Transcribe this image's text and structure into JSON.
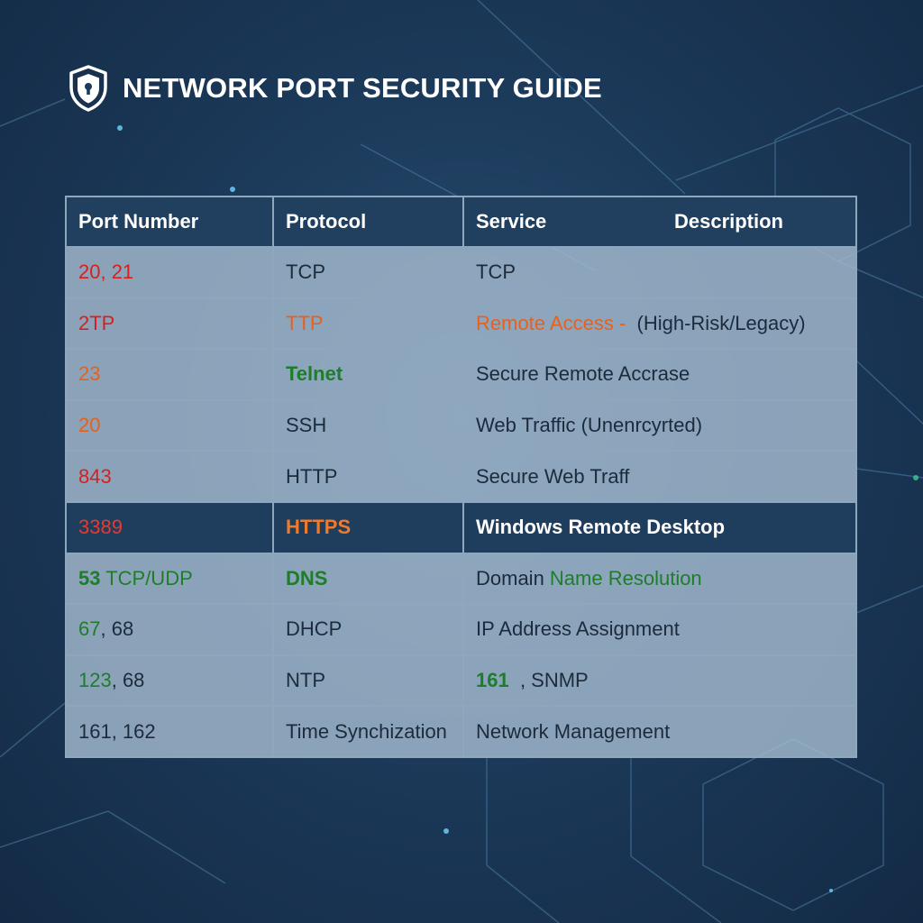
{
  "header": {
    "title": "NETWORK PORT SECURITY GUIDE"
  },
  "table": {
    "columns": [
      "Port Number",
      "Protocol",
      "Service",
      "Description"
    ],
    "rows": [
      {
        "port": "20, 21",
        "protocol": "TCP",
        "service": "TCP"
      },
      {
        "port": "2TP",
        "protocol": "TTP",
        "service_a": "Remote Access",
        "service_sep": " -  ",
        "service_b": "(High-Risk/Legacy)"
      },
      {
        "port": "23",
        "protocol": "Telnet",
        "service": "Secure Remote Accrase"
      },
      {
        "port": "20",
        "protocol": "SSH",
        "service": "Web Traffic (Unenrcyrted)"
      },
      {
        "port": "843",
        "protocol": "HTTP",
        "service": "Secure Web Traff"
      },
      {
        "port": "3389",
        "protocol": "HTTPS",
        "service": "Windows Remote Desktop"
      },
      {
        "port_a": "53",
        "port_b": " TCP/UDP",
        "protocol": "DNS",
        "service_a": "Domain ",
        "service_b": "Name Resolution"
      },
      {
        "port_a": "67",
        "port_b": ", 68",
        "protocol": "DHCP",
        "service": "IP Address Assignment"
      },
      {
        "port_a": "123",
        "port_b": ", 68",
        "protocol": "NTP",
        "service_a": "161",
        "service_b": "  , SNMP"
      },
      {
        "port": "161, 162",
        "protocol": "Time Synchization",
        "service": "Network Management"
      }
    ]
  },
  "colors": {
    "red": "#d62020",
    "orange": "#e8601c",
    "green": "#1e7d2a",
    "header_bg": "#21405f"
  }
}
